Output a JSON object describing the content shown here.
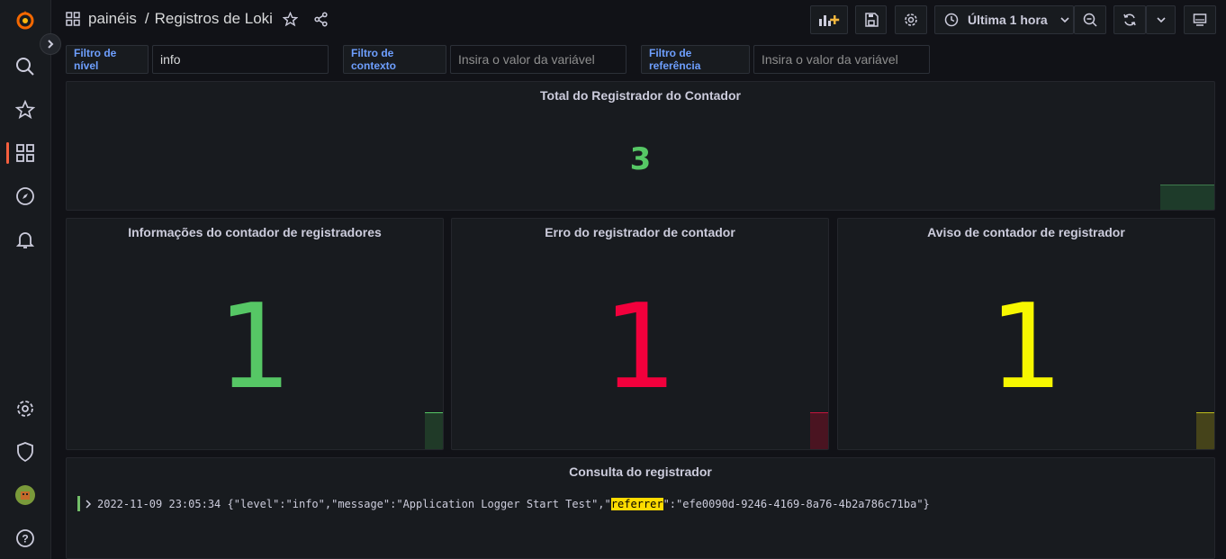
{
  "colors": {
    "green": "#73bf69",
    "stat_green": "#56c765",
    "red": "#f2003c",
    "yellow": "#f7f700",
    "accent": "#f55f3e",
    "var_label": "#6e9fff"
  },
  "sidebar": {
    "items": [
      "grafana-logo-icon",
      "search-icon",
      "star-icon",
      "dashboards-icon",
      "explore-icon",
      "alerting-icon",
      "configuration-icon",
      "server-admin-icon",
      "user-avatar",
      "help-icon"
    ]
  },
  "header": {
    "folder": "painéis",
    "separator": "/",
    "title": "Registros de Loki",
    "time_range": "Última 1 hora"
  },
  "variables": [
    {
      "label": "Filtro de nível",
      "value": "info",
      "placeholder": ""
    },
    {
      "label": "Filtro de contexto",
      "value": "",
      "placeholder": "Insira o valor da variável"
    },
    {
      "label": "Filtro de referência",
      "value": "",
      "placeholder": "Insira o valor da variável"
    }
  ],
  "panels": {
    "total": {
      "title": "Total do Registrador do Contador",
      "value": "3"
    },
    "info": {
      "title": "Informações do contador de registradores",
      "value": "1"
    },
    "error": {
      "title": "Erro do registrador de contador",
      "value": "1"
    },
    "warn": {
      "title": "Aviso de contador de registrador",
      "value": "1"
    },
    "logs": {
      "title": "Consulta do registrador",
      "line": {
        "timestamp": "2022-11-09 23:05:34",
        "before": " {\"level\":\"info\",\"message\":\"Application Logger Start Test\",\"",
        "highlight": "referrer",
        "after": "\":\"efe0090d-9246-4169-8a76-4b2a786c71ba\"}"
      }
    }
  }
}
